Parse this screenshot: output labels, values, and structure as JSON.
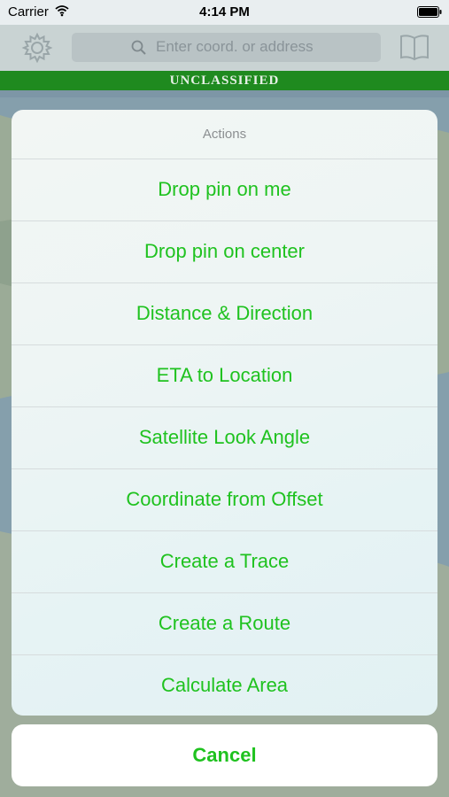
{
  "status_bar": {
    "carrier": "Carrier",
    "time": "4:14 PM",
    "wifi_icon": "wifi-icon",
    "battery_icon": "battery-icon"
  },
  "navbar": {
    "settings_icon": "gear-icon",
    "search_icon": "search-icon",
    "search_placeholder": "Enter coord. or address",
    "bookmarks_icon": "book-icon"
  },
  "classification": "UNCLASSIFIED",
  "action_sheet": {
    "title": "Actions",
    "items": [
      {
        "label": "Drop pin on me"
      },
      {
        "label": "Drop pin on center"
      },
      {
        "label": "Distance & Direction"
      },
      {
        "label": "ETA to Location"
      },
      {
        "label": "Satellite Look Angle"
      },
      {
        "label": "Coordinate from Offset"
      },
      {
        "label": "Create a Trace"
      },
      {
        "label": "Create a Route"
      },
      {
        "label": "Calculate Area"
      }
    ],
    "cancel": "Cancel"
  },
  "colors": {
    "accent": "#1fc21f",
    "classification_bar": "#1f8a1f"
  }
}
